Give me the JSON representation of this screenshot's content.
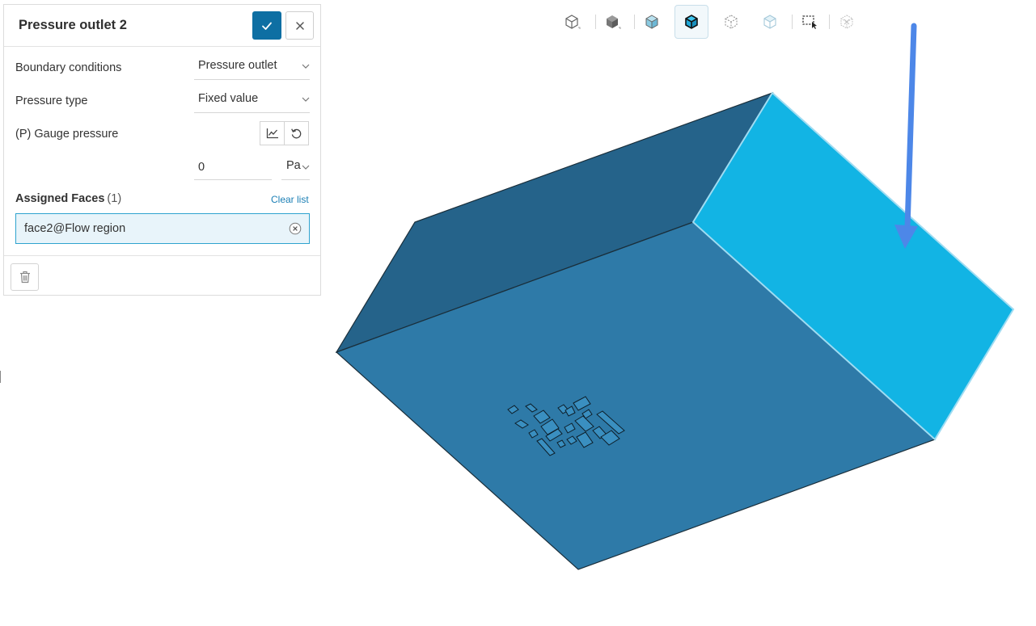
{
  "panel": {
    "title": "Pressure outlet 2",
    "confirm_icon": "check-icon",
    "close_icon": "close-icon",
    "boundary_conditions": {
      "label": "Boundary conditions",
      "value": "Pressure outlet"
    },
    "pressure_type": {
      "label": "Pressure type",
      "value": "Fixed value"
    },
    "gauge_pressure": {
      "label": "(P) Gauge pressure",
      "value": "0",
      "unit": "Pa"
    },
    "assigned_faces": {
      "label": "Assigned Faces",
      "count": "(1)",
      "clear_label": "Clear list",
      "items": [
        "face2@Flow region"
      ]
    }
  },
  "toolbar": {
    "items": [
      "view-isometric",
      "view-solid",
      "view-solid-edges",
      "view-solid-edges-active",
      "view-wireframe",
      "view-transparent",
      "box-select",
      "hidden-item"
    ],
    "active_index": 3
  },
  "colors": {
    "accent": "#0e6fa3",
    "link": "#1b7fb5",
    "face_dark": "#25638a",
    "face_main": "#2e7aa8",
    "face_selected": "#12b4e4",
    "annotation_arrow": "#4d87e8"
  }
}
